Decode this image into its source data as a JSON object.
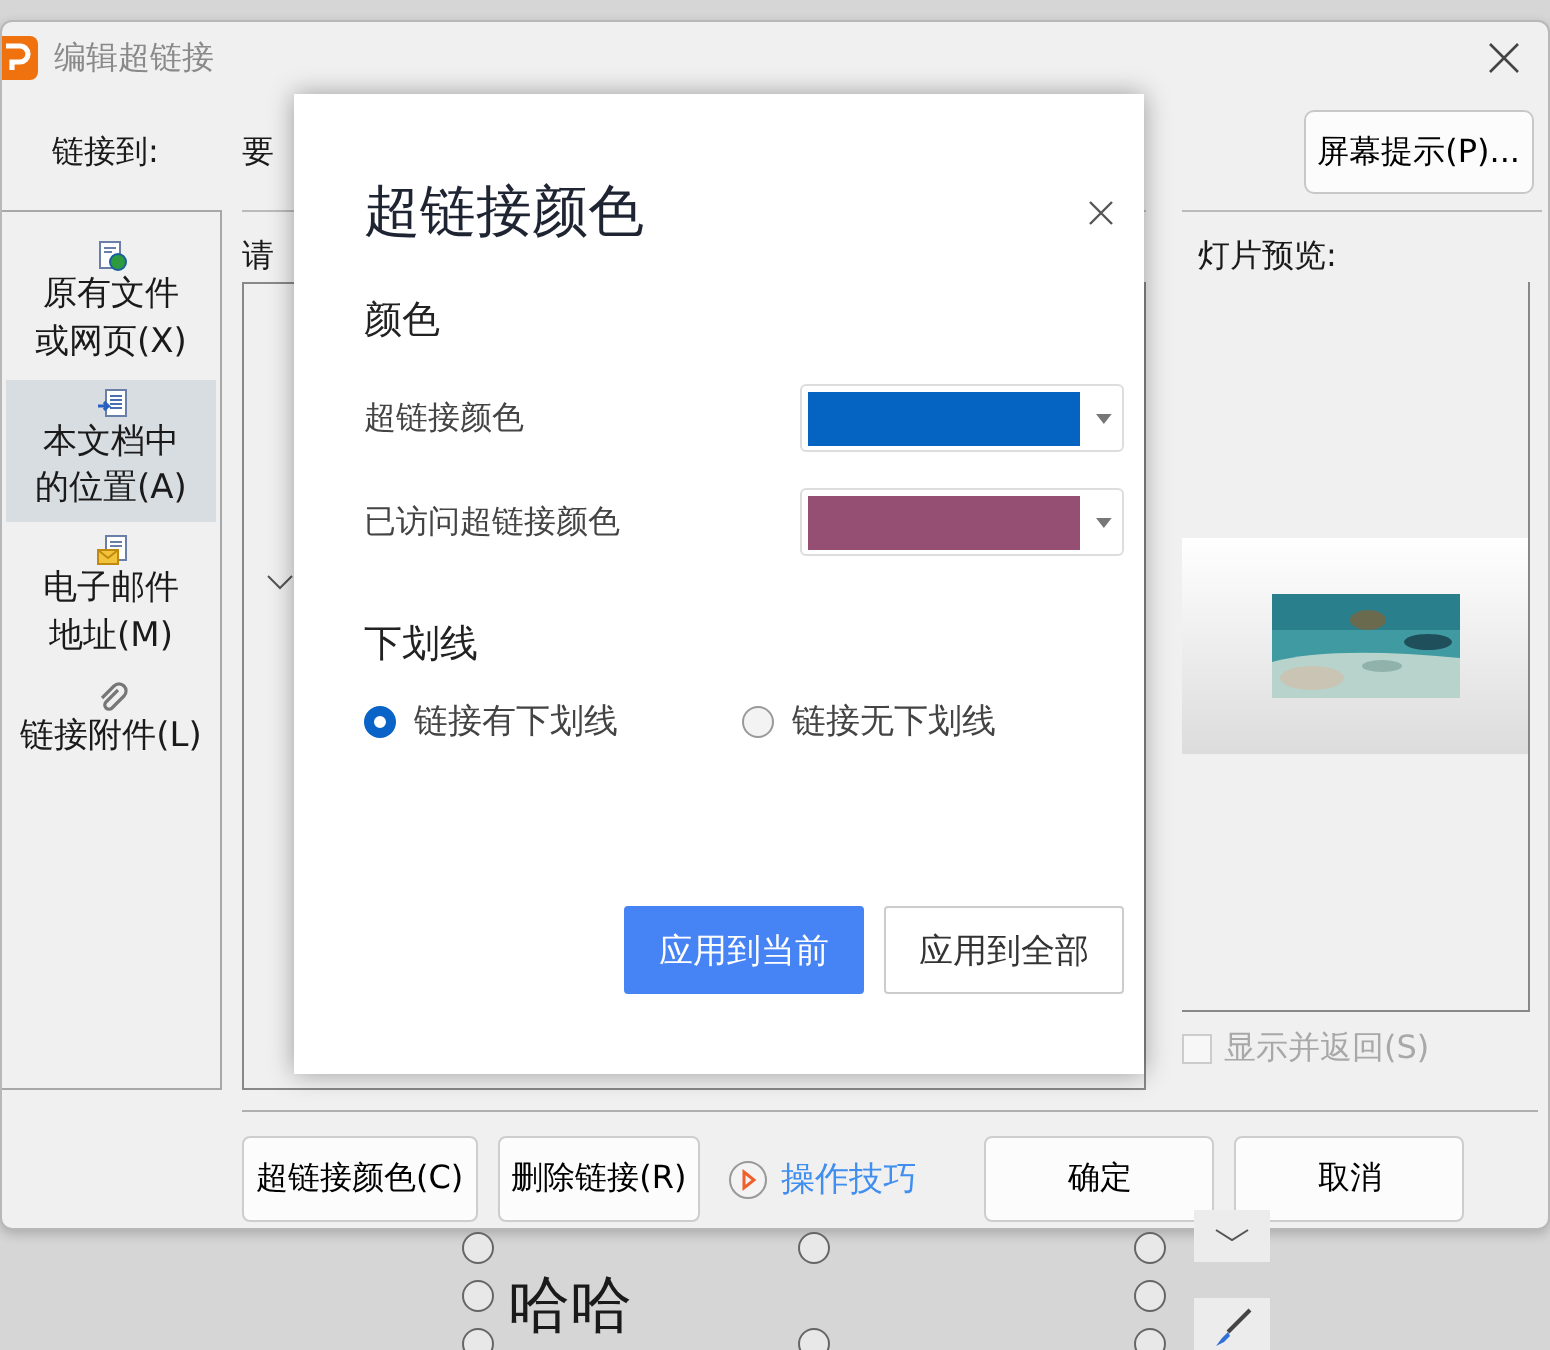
{
  "window": {
    "title": "编辑超链接"
  },
  "link_to_label": "链接到:",
  "display_text_label": "要",
  "screen_tip_button": "屏幕提示(P)...",
  "link_targets": [
    {
      "kind": "file",
      "lines": [
        "原有文件",
        "或网页(X)"
      ],
      "selected": false
    },
    {
      "kind": "document",
      "lines": [
        "本文档中",
        "的位置(A)"
      ],
      "selected": true
    },
    {
      "kind": "email",
      "lines": [
        "电子邮件",
        "地址(M)"
      ],
      "selected": false
    },
    {
      "kind": "attachment",
      "lines": [
        "链接附件(L)"
      ],
      "selected": false
    }
  ],
  "select_label": "请",
  "preview_label": "灯片预览:",
  "show_and_return": {
    "label": "显示并返回(S)",
    "checked": false,
    "disabled": true
  },
  "footer": {
    "color_button": "超链接颜色(C)",
    "remove_button": "删除链接(R)",
    "tips_link": "操作技巧",
    "ok_button": "确定",
    "cancel_button": "取消"
  },
  "color_dialog": {
    "title": "超链接颜色",
    "color_heading": "颜色",
    "color_rows": [
      {
        "label": "超链接颜色",
        "color": "#0563c1"
      },
      {
        "label": "已访问超链接颜色",
        "color": "#954f72"
      }
    ],
    "underline_heading": "下划线",
    "underline_options": [
      {
        "label": "链接有下划线",
        "selected": true
      },
      {
        "label": "链接无下划线",
        "selected": false
      }
    ],
    "buttons": [
      {
        "label": "应用到当前",
        "primary": true
      },
      {
        "label": "应用到全部",
        "primary": false
      }
    ]
  },
  "slide_text": "哈哈"
}
